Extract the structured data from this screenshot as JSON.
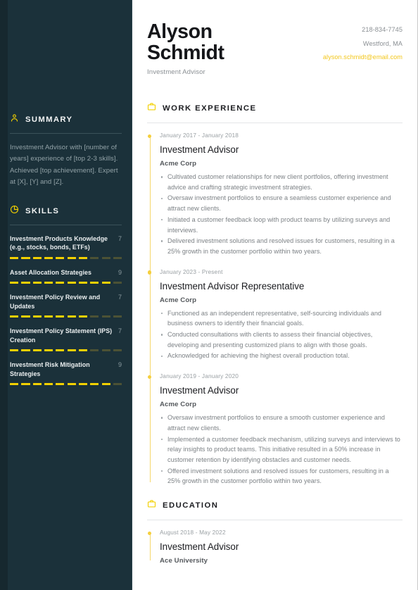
{
  "header": {
    "first_name": "Alyson",
    "last_name": "Schmidt",
    "role": "Investment Advisor",
    "phone": "218-834-7745",
    "location": "Westford, MA",
    "email": "alyson.schmidt@email.com",
    "accent_color": "#f3c71c"
  },
  "sidebar": {
    "background_color": "#1b313a",
    "summary": {
      "icon": "person-icon",
      "title": "SUMMARY",
      "text": "Investment Advisor with [number of years] experience of [top 2-3 skills]. Achieved [top achievement]. Expert at [X], [Y] and [Z]."
    },
    "skills": {
      "icon": "pie-chart-icon",
      "title": "SKILLS",
      "max": 10,
      "filled_color": "#f2d000",
      "empty_color": "#4c5235",
      "items": [
        {
          "name": "Investment Products Knowledge (e.g., stocks, bonds, ETFs)",
          "score": 7
        },
        {
          "name": "Asset Allocation Strategies",
          "score": 9
        },
        {
          "name": "Investment Policy Review and Updates",
          "score": 7
        },
        {
          "name": "Investment Policy Statement (IPS) Creation",
          "score": 7
        },
        {
          "name": "Investment Risk Mitigation Strategies",
          "score": 9
        }
      ]
    }
  },
  "main": {
    "work_experience": {
      "icon": "briefcase-icon",
      "title": "WORK EXPERIENCE",
      "entries": [
        {
          "date": "January 2017 - January 2018",
          "title": "Investment Advisor",
          "org": "Acme Corp",
          "bullets": [
            "Cultivated customer relationships for new client portfolios, offering investment advice and crafting strategic investment strategies.",
            "Oversaw investment portfolios to ensure a seamless customer experience and attract new clients.",
            "Initiated a customer feedback loop with product teams by utilizing surveys and interviews.",
            "Delivered investment solutions and resolved issues for customers, resulting in a 25% growth in the customer portfolio within two years."
          ]
        },
        {
          "date": "January 2023 - Present",
          "title": "Investment Advisor Representative",
          "org": "Acme Corp",
          "bullets": [
            "Functioned as an independent representative, self-sourcing individuals and business owners to identify their financial goals.",
            "Conducted consultations with clients to assess their financial objectives, developing and presenting customized plans to align with those goals.",
            "Acknowledged for achieving the highest overall production total."
          ]
        },
        {
          "date": "January 2019 - January 2020",
          "title": "Investment Advisor",
          "org": "Acme Corp",
          "bullets": [
            "Oversaw investment portfolios to ensure a smooth customer experience and attract new clients.",
            "Implemented a customer feedback mechanism, utilizing surveys and interviews to relay insights to product teams. This initiative resulted in a 50% increase in customer retention by identifying obstacles and customer needs.",
            "Offered investment solutions and resolved issues for customers, resulting in a 25% growth in the customer portfolio within two years."
          ]
        }
      ]
    },
    "education": {
      "icon": "briefcase-icon",
      "title": "EDUCATION",
      "entries": [
        {
          "date": "August 2018 - May 2022",
          "title": "Investment Advisor",
          "org": "Ace University"
        }
      ]
    }
  }
}
